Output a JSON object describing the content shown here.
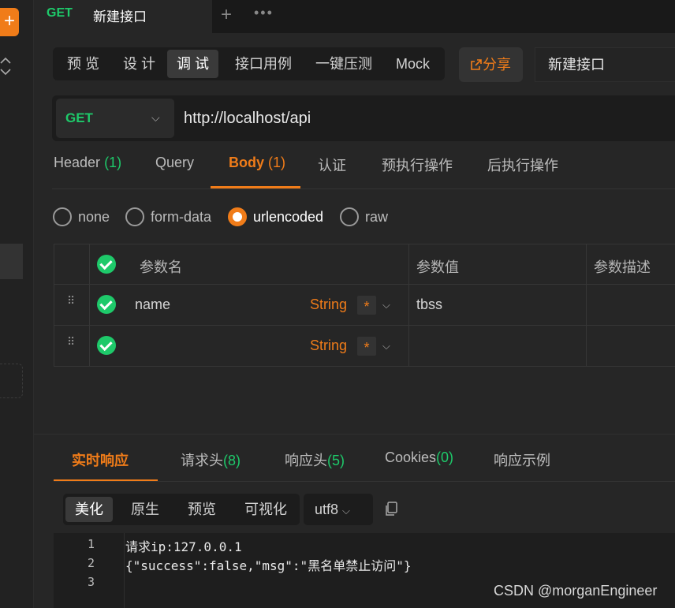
{
  "sidebar": {
    "add_icon": "+"
  },
  "tabbar": {
    "method": "GET",
    "name": "新建接口",
    "plus_icon": "+",
    "more_icon": "•••"
  },
  "modes": [
    "预 览",
    "设 计",
    "调 试",
    "接口用例",
    "一键压测",
    "Mock"
  ],
  "active_mode": "调 试",
  "share_label": "分享",
  "api_name": "新建接口",
  "request": {
    "method": "GET",
    "url": "http://localhost/api"
  },
  "req_tabs": [
    {
      "label": "Header",
      "count": "(1)"
    },
    {
      "label": "Query",
      "count": ""
    },
    {
      "label": "Body",
      "count": "(1)"
    },
    {
      "label": "认证",
      "count": ""
    },
    {
      "label": "预执行操作",
      "count": ""
    },
    {
      "label": "后执行操作",
      "count": ""
    }
  ],
  "body_types": [
    "none",
    "form-data",
    "urlencoded",
    "raw"
  ],
  "selected_body_type": "urlencoded",
  "table": {
    "headers": [
      "参数名",
      "参数值",
      "参数描述"
    ],
    "rows": [
      {
        "name": "name",
        "type": "String",
        "required": "*",
        "value": "tbss",
        "desc": ""
      },
      {
        "name": "",
        "type": "String",
        "required": "*",
        "value": "",
        "desc": ""
      }
    ]
  },
  "resp_tabs": [
    {
      "label": "实时响应",
      "count": ""
    },
    {
      "label": "请求头",
      "count": "(8)"
    },
    {
      "label": "响应头",
      "count": "(5)"
    },
    {
      "label": "Cookies",
      "count": "(0)"
    },
    {
      "label": "响应示例",
      "count": ""
    }
  ],
  "view_modes": [
    "美化",
    "原生",
    "预览",
    "可视化"
  ],
  "active_view": "美化",
  "encoding": "utf8",
  "code_lines": [
    {
      "n": "1",
      "text": "请求ip:127.0.0.1"
    },
    {
      "n": "2",
      "text": "{\"success\":false,\"msg\":\"黑名单禁止访问\"}"
    },
    {
      "n": "3",
      "text": ""
    }
  ],
  "watermark": "CSDN @morganEngineer",
  "colors": {
    "accent": "#f07c19",
    "get_green": "#1ec96a",
    "background": "#262626"
  }
}
